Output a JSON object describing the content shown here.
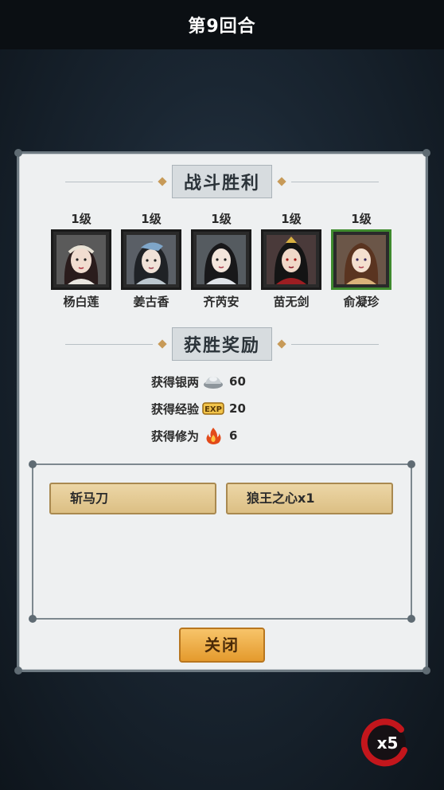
{
  "header": {
    "round_title": "第9回合"
  },
  "panel": {
    "battle_title": "战斗胜利",
    "reward_title": "获胜奖励",
    "heroes": [
      {
        "level": "1级",
        "name": "杨白莲",
        "selected": false
      },
      {
        "level": "1级",
        "name": "姜古香",
        "selected": false
      },
      {
        "level": "1级",
        "name": "齐芮安",
        "selected": false
      },
      {
        "level": "1级",
        "name": "苗无剑",
        "selected": false
      },
      {
        "level": "1级",
        "name": "俞凝珍",
        "selected": true
      }
    ],
    "rewards": [
      {
        "label": "获得银两",
        "icon": "silver-ingot-icon",
        "value": "60"
      },
      {
        "label": "获得经验",
        "icon": "exp-icon",
        "value": "20"
      },
      {
        "label": "获得修为",
        "icon": "flame-icon",
        "value": "6"
      }
    ],
    "items": [
      "斩马刀",
      "狼王之心x1"
    ],
    "close_label": "关闭"
  },
  "speed": {
    "label": "x5"
  },
  "colors": {
    "accent": "#e49a2d",
    "selected_frame": "#3f8a2e",
    "speed_ring": "#c3161c"
  }
}
